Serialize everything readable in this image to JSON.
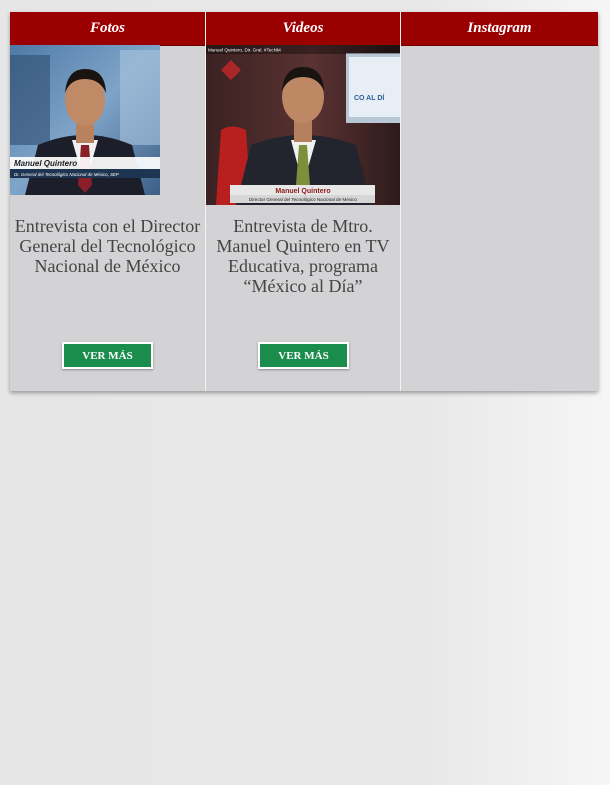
{
  "columns": [
    {
      "header": "Fotos",
      "thumb_label_name": "Manuel Quintero",
      "thumb_label_title": "Dr. General del Tecnológico Nacional de México, SEP",
      "caption": "Entrevista con el Director General del Tecnológico Nacional de México",
      "button": "VER MÁS"
    },
    {
      "header": "Videos",
      "thumb_top_text": "Manuel Quintero, Dir. Gral. #TecNM",
      "thumb_label_name": "Manuel Quintero",
      "thumb_label_title": "Director General del Tecnológico Nacional de México",
      "caption": "Entrevista de Mtro. Manuel Quintero en TV Educativa, programa “México al Día”",
      "button": "VER MÁS"
    },
    {
      "header": "Instagram"
    }
  ],
  "colors": {
    "header_bg": "#9b0000",
    "panel_bg": "#d3d3d5",
    "button_bg": "#1a8c4c"
  }
}
